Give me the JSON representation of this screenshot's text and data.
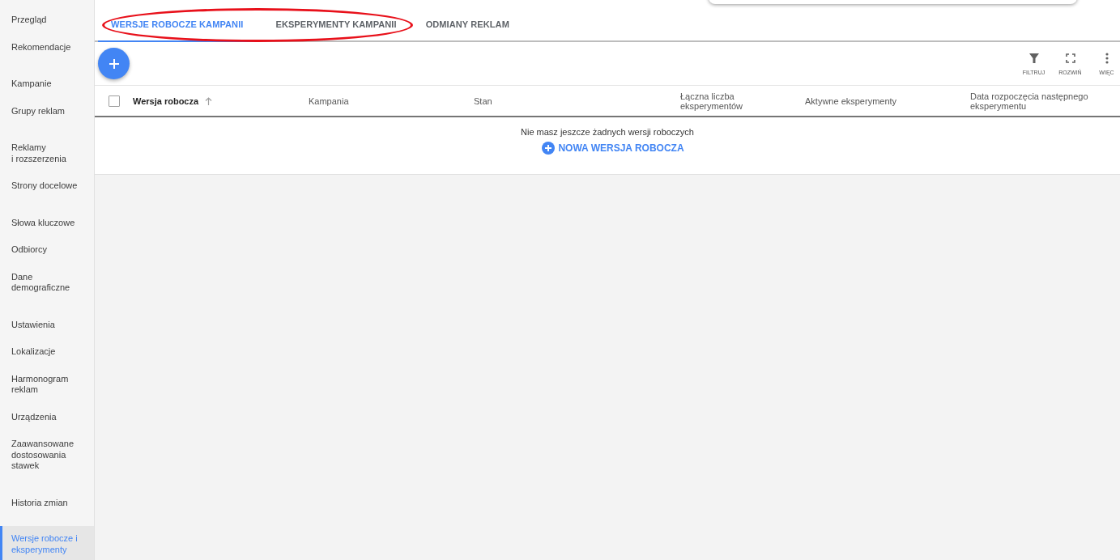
{
  "sidebar": {
    "groups": [
      {
        "items": [
          {
            "label": "Przegląd",
            "selected": false
          },
          {
            "label": "Rekomendacje",
            "selected": false
          }
        ]
      },
      {
        "items": [
          {
            "label": "Kampanie",
            "selected": false
          },
          {
            "label": "Grupy reklam",
            "selected": false
          }
        ]
      },
      {
        "items": [
          {
            "label": "Reklamy\ni rozszerzenia",
            "selected": false
          },
          {
            "label": "Strony docelowe",
            "selected": false
          }
        ]
      },
      {
        "items": [
          {
            "label": "Słowa kluczowe",
            "selected": false
          },
          {
            "label": "Odbiorcy",
            "selected": false
          },
          {
            "label": "Dane\ndemograficzne",
            "selected": false
          }
        ]
      },
      {
        "items": [
          {
            "label": "Ustawienia",
            "selected": false
          },
          {
            "label": "Lokalizacje",
            "selected": false
          },
          {
            "label": "Harmonogram\nreklam",
            "selected": false
          },
          {
            "label": "Urządzenia",
            "selected": false
          },
          {
            "label": "Zaawansowane\ndostosowania\nstawek",
            "selected": false
          }
        ]
      },
      {
        "items": [
          {
            "label": "Historia zmian",
            "selected": false
          }
        ]
      },
      {
        "items": [
          {
            "label": "Wersje robocze i\neksperymenty",
            "selected": true
          }
        ]
      }
    ]
  },
  "tabs": [
    {
      "label": "WERSJE ROBOCZE KAMPANII",
      "selected": true
    },
    {
      "label": "EKSPERYMENTY KAMPANII",
      "selected": false
    },
    {
      "label": "ODMIANY REKLAM",
      "selected": false
    }
  ],
  "toolbar": [
    {
      "kind": "filter",
      "label": "FILTRUJ"
    },
    {
      "kind": "expand",
      "label": "ROZWIŃ"
    },
    {
      "kind": "more",
      "label": "WIĘC"
    }
  ],
  "table": {
    "select_all": {
      "checked": false
    },
    "columns": [
      {
        "label": "Wersja robocza",
        "sorted": true
      },
      {
        "label": "Kampania",
        "sorted": false
      },
      {
        "label": "Stan",
        "sorted": false
      },
      {
        "label": "Łączna liczba eksperymentów",
        "sorted": false
      },
      {
        "label": "Aktywne eksperymenty",
        "sorted": false
      },
      {
        "label": "Data rozpoczęcia następnego eksperymentu",
        "sorted": false
      }
    ],
    "empty_message": "Nie masz jeszcze żadnych wersji roboczych",
    "new_button": "NOWA WERSJA ROBOCZA"
  }
}
